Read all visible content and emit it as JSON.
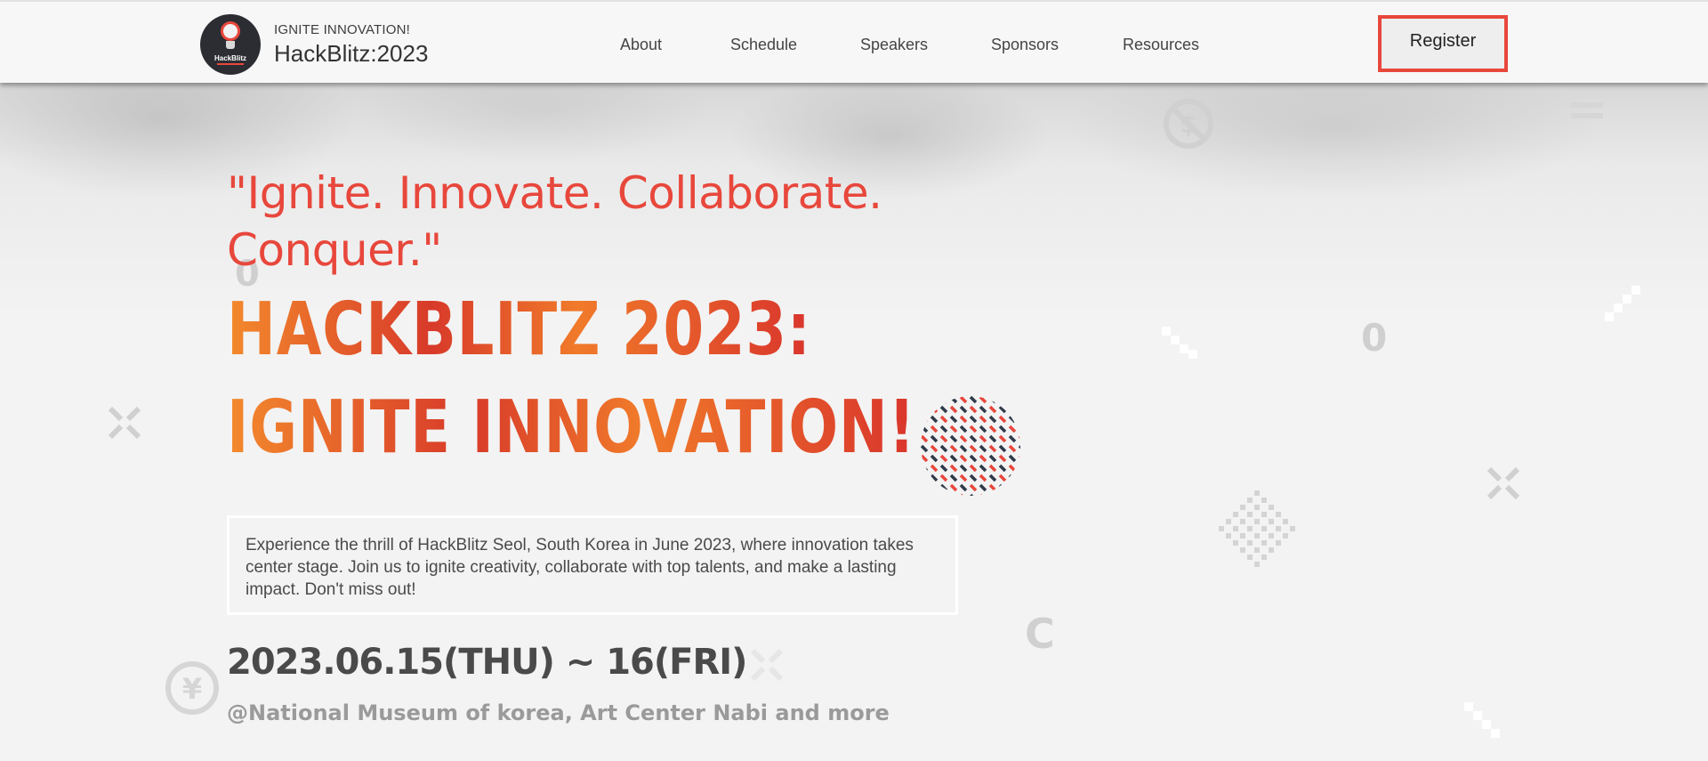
{
  "header": {
    "brand_tagline": "IGNITE INNOVATION!",
    "brand_name": "HackBlitz:2023",
    "logo_text": "HackBlitz",
    "nav": [
      {
        "label": "About"
      },
      {
        "label": "Schedule"
      },
      {
        "label": "Speakers"
      },
      {
        "label": "Sponsors"
      },
      {
        "label": "Resources"
      }
    ],
    "register_label": "Register"
  },
  "hero": {
    "quote": "\"Ignite. Innovate. Collaborate. Conquer.\"",
    "title_line1": "HACKBLITZ 2023:",
    "title_line2": "IGNITE INNOVATION!",
    "description": "Experience the thrill of HackBlitz Seol, South Korea in June 2023, where innovation takes center stage. Join us to ignite creativity, collaborate with top talents, and make a lasting impact. Don't miss out!",
    "date": "2023.06.15(THU) ~ 16(FRI)",
    "venue": "@National Museum of korea, Art Center Nabi and more"
  },
  "colors": {
    "accent": "#e8473c",
    "title_orange": "#f38a2c",
    "title_red": "#d83a2a",
    "text_dark": "#4a4a4a",
    "text_muted": "#9a9a9a"
  },
  "icons": [
    "lightbulb-logo-icon",
    "no-dollar-icon",
    "yen-icon",
    "equals-icon",
    "cross-icon",
    "dot-pattern-icon"
  ]
}
